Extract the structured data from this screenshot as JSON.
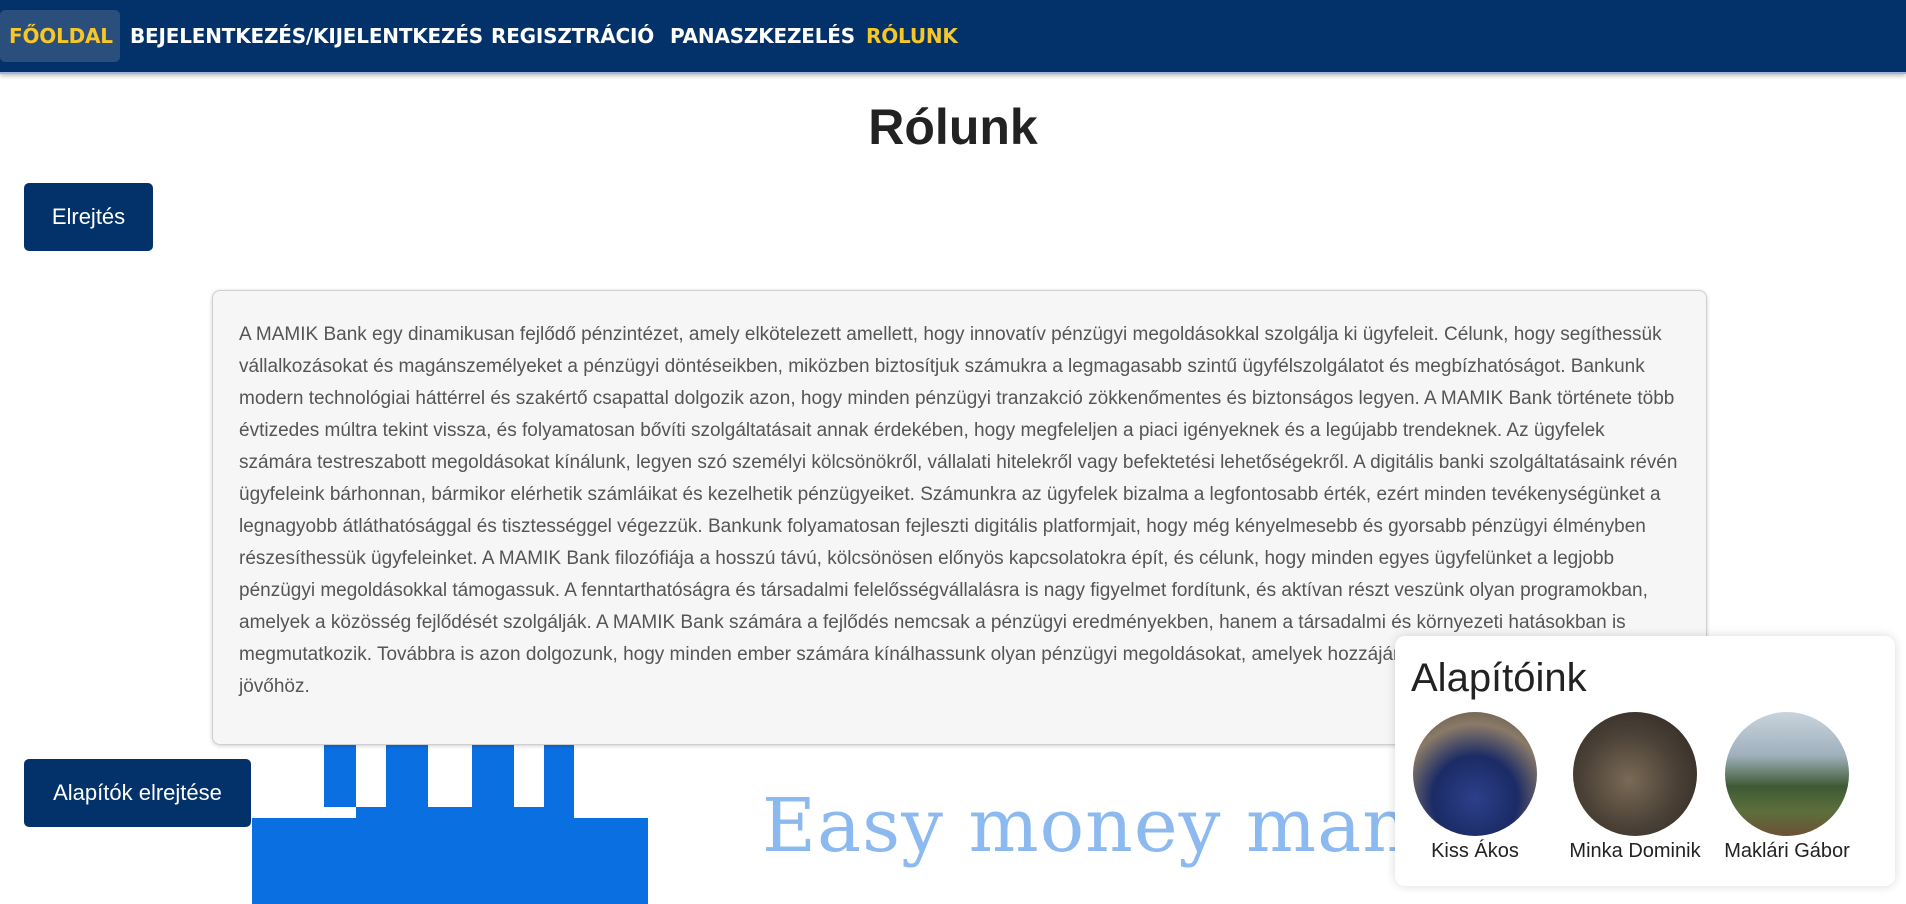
{
  "nav": {
    "items": [
      {
        "label": "FŐOLDAL"
      },
      {
        "label": "BEJELENTKEZÉS/KIJELENTKEZÉS"
      },
      {
        "label": "REGISZTRÁCIÓ"
      },
      {
        "label": "PANASZKEZELÉS"
      },
      {
        "label": "RÓLUNK"
      }
    ]
  },
  "page": {
    "title": "Rólunk",
    "hide_button": "Elrejtés",
    "founders_hide_button": "Alapítók elrejtése",
    "slogan": "Easy money mana",
    "about_text": "A MAMIK Bank egy dinamikusan fejlődő pénzintézet, amely elkötelezett amellett, hogy innovatív pénzügyi megoldásokkal szolgálja ki ügyfeleit. Célunk, hogy segíthessük vállalkozásokat és magánszemélyeket a pénzügyi döntéseikben, miközben biztosítjuk számukra a legmagasabb szintű ügyfélszolgálatot és megbízhatóságot. Bankunk modern technológiai háttérrel és szakértő csapattal dolgozik azon, hogy minden pénzügyi tranzakció zökkenőmentes és biztonságos legyen. A MAMIK Bank története több évtizedes múltra tekint vissza, és folyamatosan bővíti szolgáltatásait annak érdekében, hogy megfeleljen a piaci igényeknek és a legújabb trendeknek. Az ügyfelek számára testreszabott megoldásokat kínálunk, legyen szó személyi kölcsönökről, vállalati hitelekről vagy befektetési lehetőségekről. A digitális banki szolgáltatásaink révén ügyfeleink bárhonnan, bármikor elérhetik számláikat és kezelhetik pénzügyeiket. Számunkra az ügyfelek bizalma a legfontosabb érték, ezért minden tevékenységünket a legnagyobb átláthatósággal és tisztességgel végezzük. Bankunk folyamatosan fejleszti digitális platformjait, hogy még kényelmesebb és gyorsabb pénzügyi élményben részesíthessük ügyfeleinket. A MAMIK Bank filozófiája a hosszú távú, kölcsönösen előnyös kapcsolatokra épít, és célunk, hogy minden egyes ügyfelünket a legjobb pénzügyi megoldásokkal támogassuk. A fenntarthatóságra és társadalmi felelősségvállalásra is nagy figyelmet fordítunk, és aktívan részt veszünk olyan programokban, amelyek a közösség fejlődését szolgálják. A MAMIK Bank számára a fejlődés nemcsak a pénzügyi eredményekben, hanem a társadalmi és környezeti hatásokban is megmutatkozik. Továbbra is azon dolgozunk, hogy minden ember számára kínálhassunk olyan pénzügyi megoldásokat, amelyek hozzájárulnak a sikeres és biztos jövőhöz."
  },
  "founders": {
    "title": "Alapítóink",
    "people": [
      {
        "name": "Kiss Ákos"
      },
      {
        "name": "Minka Dominik"
      },
      {
        "name": "Maklári Gábor"
      }
    ]
  },
  "colors": {
    "navbar": "#03326a",
    "accent_yellow": "#f7c727",
    "logo_blue": "#0a6fe0",
    "slogan_blue": "#8cb9ef"
  }
}
